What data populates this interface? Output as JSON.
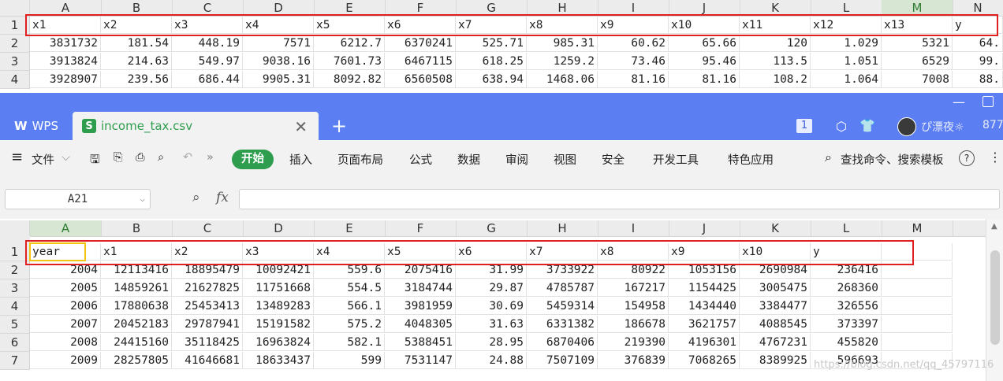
{
  "top_sheet": {
    "columns": [
      "A",
      "B",
      "C",
      "D",
      "E",
      "F",
      "G",
      "H",
      "I",
      "J",
      "K",
      "L",
      "M",
      "N"
    ],
    "selected_column": "M",
    "rows": [
      "1",
      "2",
      "3",
      "4"
    ],
    "header": [
      "x1",
      "x2",
      "x3",
      "x4",
      "x5",
      "x6",
      "x7",
      "x8",
      "x9",
      "x10",
      "x11",
      "x12",
      "x13",
      "y"
    ],
    "data": [
      [
        "3831732",
        "181.54",
        "448.19",
        "7571",
        "6212.7",
        "6370241",
        "525.71",
        "985.31",
        "60.62",
        "65.66",
        "120",
        "1.029",
        "5321",
        "64."
      ],
      [
        "3913824",
        "214.63",
        "549.97",
        "9038.16",
        "7601.73",
        "6467115",
        "618.25",
        "1259.2",
        "73.46",
        "95.46",
        "113.5",
        "1.051",
        "6529",
        "99."
      ],
      [
        "3928907",
        "239.56",
        "686.44",
        "9905.31",
        "8092.82",
        "6560508",
        "638.94",
        "1468.06",
        "81.16",
        "81.16",
        "108.2",
        "1.064",
        "7008",
        "88."
      ]
    ]
  },
  "app": {
    "wps_label": "WPS",
    "file_name": "income_tax.csv",
    "plus": "+",
    "close": "✕",
    "badge": "1",
    "user": "ぴ漂夜☼",
    "user_extra": "877"
  },
  "toolbar": {
    "file_menu": "文件",
    "start": "开始",
    "insert": "插入",
    "page_layout": "页面布局",
    "formula": "公式",
    "data": "数据",
    "review": "审阅",
    "view": "视图",
    "security": "安全",
    "dev_tools": "开发工具",
    "special": "特色应用",
    "search": "查找命令、搜索模板"
  },
  "formula_bar": {
    "cell_ref": "A21",
    "fx": "fx",
    "value": ""
  },
  "main_sheet": {
    "columns": [
      "A",
      "B",
      "C",
      "D",
      "E",
      "F",
      "G",
      "H",
      "I",
      "J",
      "K",
      "L",
      "M"
    ],
    "selected_column": "A",
    "rows": [
      "1",
      "2",
      "3",
      "4",
      "5",
      "6",
      "7"
    ],
    "header": [
      "year",
      "x1",
      "x2",
      "x3",
      "x4",
      "x5",
      "x6",
      "x7",
      "x8",
      "x9",
      "x10",
      "y",
      ""
    ],
    "data": [
      [
        "2004",
        "12113416",
        "18895479",
        "10092421",
        "559.6",
        "2075416",
        "31.99",
        "3733922",
        "80922",
        "1053156",
        "2690984",
        "236416",
        ""
      ],
      [
        "2005",
        "14859261",
        "21627825",
        "11751668",
        "554.5",
        "3184744",
        "29.87",
        "4785787",
        "167217",
        "1154425",
        "3005475",
        "268360",
        ""
      ],
      [
        "2006",
        "17880638",
        "25453413",
        "13489283",
        "566.1",
        "3981959",
        "30.69",
        "5459314",
        "154958",
        "1434440",
        "3384477",
        "326556",
        ""
      ],
      [
        "2007",
        "20452183",
        "29787941",
        "15191582",
        "575.2",
        "4048305",
        "31.63",
        "6331382",
        "186678",
        "3621757",
        "4088545",
        "373397",
        ""
      ],
      [
        "2008",
        "24415160",
        "35118425",
        "16963824",
        "582.1",
        "5388451",
        "28.95",
        "6870406",
        "219390",
        "4196301",
        "4767231",
        "455820",
        ""
      ],
      [
        "2009",
        "28257805",
        "41646681",
        "18633437",
        "599",
        "7531147",
        "24.88",
        "7507109",
        "376839",
        "7068265",
        "8389925",
        "596693",
        ""
      ]
    ]
  },
  "watermark": "https://blog.csdn.net/qq_45797116"
}
